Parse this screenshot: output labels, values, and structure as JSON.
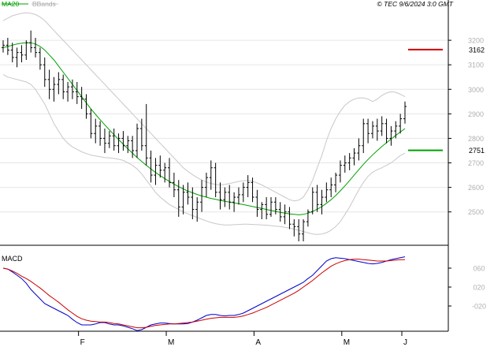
{
  "header": {
    "legend_ma": "MA20",
    "legend_bb": "BBands",
    "timestamp": "© TEC 9/6/2024 3:0 GMT"
  },
  "colors": {
    "bars": "#000000",
    "ma20": "#00a000",
    "bbands": "#c8c8c8",
    "grid": "#e6e6e6",
    "resistance": "#d00000",
    "support": "#00a000",
    "macd": "#0000cc",
    "signal": "#cc0000",
    "axis_text": "#b0b0b0"
  },
  "chart_data": [
    {
      "type": "ohlc",
      "title": "",
      "y_tick_labels": [
        "2500",
        "2600",
        "2700",
        "2800",
        "2900",
        "3000",
        "3100",
        "3200"
      ],
      "x_tick_labels": [
        "F",
        "M",
        "A",
        "M",
        "J"
      ],
      "ylim": [
        2380,
        3300
      ],
      "grid": true,
      "series": [
        {
          "name": "MA20",
          "type": "line",
          "values": [
            3170,
            3175,
            3180,
            3185,
            3188,
            3190,
            3190,
            3185,
            3175,
            3160,
            3140,
            3120,
            3095,
            3070,
            3045,
            3020,
            2995,
            2970,
            2945,
            2920,
            2898,
            2876,
            2855,
            2835,
            2815,
            2795,
            2776,
            2757,
            2740,
            2722,
            2706,
            2690,
            2675,
            2661,
            2648,
            2636,
            2624,
            2613,
            2603,
            2594,
            2585,
            2578,
            2571,
            2565,
            2560,
            2555,
            2551,
            2547,
            2543,
            2540,
            2537,
            2533,
            2530,
            2526,
            2522,
            2518,
            2514,
            2510,
            2506,
            2502,
            2498,
            2495,
            2492,
            2490,
            2488,
            2490,
            2495,
            2502,
            2511,
            2522,
            2535,
            2550,
            2567,
            2586,
            2606,
            2628,
            2650,
            2672,
            2694,
            2714,
            2733,
            2750,
            2767,
            2782,
            2797,
            2812,
            2826,
            2840
          ]
        },
        {
          "name": "BBands upper",
          "type": "line",
          "values": [
            3280,
            3290,
            3300,
            3305,
            3310,
            3312,
            3310,
            3305,
            3295,
            3280,
            3260,
            3240,
            3220,
            3200,
            3180,
            3160,
            3140,
            3120,
            3100,
            3080,
            3060,
            3040,
            3020,
            3000,
            2980,
            2960,
            2940,
            2920,
            2900,
            2880,
            2860,
            2840,
            2820,
            2800,
            2780,
            2760,
            2740,
            2720,
            2700,
            2680,
            2665,
            2652,
            2640,
            2630,
            2622,
            2616,
            2612,
            2610,
            2612,
            2616,
            2620,
            2624,
            2627,
            2628,
            2625,
            2618,
            2610,
            2600,
            2590,
            2580,
            2570,
            2560,
            2550,
            2545,
            2548,
            2560,
            2590,
            2630,
            2680,
            2730,
            2790,
            2840,
            2880,
            2910,
            2935,
            2950,
            2960,
            2965,
            2965,
            2960,
            2950,
            2960,
            2975,
            2985,
            2990,
            2988,
            2980,
            2970
          ]
        },
        {
          "name": "BBands lower",
          "type": "line",
          "values": [
            3060,
            3050,
            3045,
            3040,
            3035,
            3030,
            3020,
            3000,
            2970,
            2940,
            2900,
            2860,
            2830,
            2800,
            2780,
            2765,
            2755,
            2745,
            2738,
            2732,
            2728,
            2725,
            2722,
            2720,
            2718,
            2715,
            2710,
            2700,
            2690,
            2675,
            2655,
            2630,
            2605,
            2580,
            2560,
            2545,
            2530,
            2520,
            2510,
            2500,
            2492,
            2485,
            2478,
            2470,
            2463,
            2457,
            2452,
            2449,
            2447,
            2447,
            2448,
            2449,
            2450,
            2450,
            2449,
            2448,
            2447,
            2446,
            2444,
            2442,
            2440,
            2437,
            2434,
            2430,
            2425,
            2420,
            2415,
            2410,
            2408,
            2410,
            2415,
            2425,
            2440,
            2460,
            2490,
            2520,
            2555,
            2590,
            2620,
            2645,
            2662,
            2672,
            2680,
            2690,
            2700,
            2715,
            2730,
            2740
          ]
        },
        {
          "name": "OHLC",
          "type": "ohlc",
          "ohlc": [
            [
              3170,
              3200,
              3150,
              3180
            ],
            [
              3180,
              3210,
              3140,
              3160
            ],
            [
              3160,
              3190,
              3110,
              3130
            ],
            [
              3130,
              3170,
              3090,
              3150
            ],
            [
              3150,
              3180,
              3110,
              3140
            ],
            [
              3140,
              3200,
              3120,
              3190
            ],
            [
              3190,
              3240,
              3150,
              3170
            ],
            [
              3170,
              3210,
              3130,
              3150
            ],
            [
              3150,
              3170,
              3080,
              3100
            ],
            [
              3100,
              3130,
              3010,
              3040
            ],
            [
              3040,
              3080,
              2960,
              3000
            ],
            [
              3000,
              3050,
              2950,
              3020
            ],
            [
              3020,
              3070,
              2980,
              3040
            ],
            [
              3040,
              3060,
              2960,
              2990
            ],
            [
              2990,
              3030,
              2950,
              3010
            ],
            [
              3010,
              3040,
              2960,
              2990
            ],
            [
              2990,
              3030,
              2940,
              2970
            ],
            [
              2970,
              3010,
              2920,
              2960
            ],
            [
              2960,
              2980,
              2880,
              2900
            ],
            [
              2900,
              2920,
              2800,
              2820
            ],
            [
              2820,
              2880,
              2780,
              2850
            ],
            [
              2850,
              2870,
              2770,
              2800
            ],
            [
              2800,
              2840,
              2740,
              2780
            ],
            [
              2780,
              2830,
              2760,
              2810
            ],
            [
              2810,
              2840,
              2750,
              2770
            ],
            [
              2770,
              2820,
              2740,
              2800
            ],
            [
              2800,
              2830,
              2750,
              2770
            ],
            [
              2770,
              2810,
              2740,
              2790
            ],
            [
              2790,
              2810,
              2720,
              2750
            ],
            [
              2750,
              2860,
              2720,
              2840
            ],
            [
              2840,
              2880,
              2750,
              2770
            ],
            [
              2770,
              2940,
              2690,
              2720
            ],
            [
              2720,
              2750,
              2620,
              2650
            ],
            [
              2650,
              2720,
              2610,
              2690
            ],
            [
              2690,
              2730,
              2640,
              2670
            ],
            [
              2670,
              2700,
              2620,
              2680
            ],
            [
              2680,
              2720,
              2600,
              2620
            ],
            [
              2620,
              2660,
              2560,
              2590
            ],
            [
              2590,
              2630,
              2480,
              2520
            ],
            [
              2520,
              2610,
              2490,
              2580
            ],
            [
              2580,
              2620,
              2530,
              2560
            ],
            [
              2560,
              2600,
              2470,
              2510
            ],
            [
              2510,
              2560,
              2460,
              2540
            ],
            [
              2540,
              2630,
              2500,
              2600
            ],
            [
              2600,
              2660,
              2560,
              2640
            ],
            [
              2640,
              2710,
              2590,
              2680
            ],
            [
              2680,
              2700,
              2560,
              2580
            ],
            [
              2580,
              2620,
              2510,
              2550
            ],
            [
              2550,
              2600,
              2520,
              2580
            ],
            [
              2580,
              2610,
              2510,
              2540
            ],
            [
              2540,
              2580,
              2500,
              2560
            ],
            [
              2560,
              2600,
              2530,
              2570
            ],
            [
              2570,
              2620,
              2540,
              2600
            ],
            [
              2600,
              2650,
              2560,
              2620
            ],
            [
              2620,
              2640,
              2540,
              2560
            ],
            [
              2560,
              2590,
              2480,
              2510
            ],
            [
              2510,
              2540,
              2470,
              2530
            ],
            [
              2530,
              2560,
              2470,
              2490
            ],
            [
              2490,
              2560,
              2480,
              2540
            ],
            [
              2540,
              2560,
              2490,
              2510
            ],
            [
              2510,
              2540,
              2460,
              2480
            ],
            [
              2480,
              2530,
              2450,
              2500
            ],
            [
              2500,
              2520,
              2430,
              2450
            ],
            [
              2450,
              2470,
              2400,
              2440
            ],
            [
              2440,
              2470,
              2380,
              2410
            ],
            [
              2410,
              2470,
              2380,
              2460
            ],
            [
              2460,
              2510,
              2440,
              2500
            ],
            [
              2500,
              2600,
              2490,
              2580
            ],
            [
              2580,
              2610,
              2500,
              2530
            ],
            [
              2530,
              2590,
              2490,
              2560
            ],
            [
              2560,
              2620,
              2540,
              2590
            ],
            [
              2590,
              2640,
              2560,
              2610
            ],
            [
              2610,
              2660,
              2580,
              2650
            ],
            [
              2650,
              2710,
              2620,
              2690
            ],
            [
              2690,
              2730,
              2660,
              2700
            ],
            [
              2700,
              2740,
              2670,
              2720
            ],
            [
              2720,
              2760,
              2690,
              2740
            ],
            [
              2740,
              2800,
              2710,
              2770
            ],
            [
              2770,
              2880,
              2740,
              2860
            ],
            [
              2860,
              2880,
              2780,
              2820
            ],
            [
              2820,
              2870,
              2800,
              2850
            ],
            [
              2850,
              2880,
              2790,
              2830
            ],
            [
              2830,
              2890,
              2810,
              2860
            ],
            [
              2860,
              2880,
              2780,
              2800
            ],
            [
              2800,
              2850,
              2770,
              2830
            ],
            [
              2830,
              2870,
              2800,
              2850
            ],
            [
              2850,
              2900,
              2820,
              2880
            ],
            [
              2880,
              2950,
              2860,
              2930
            ]
          ]
        }
      ],
      "annotations": [
        {
          "label": "3162",
          "value": 3162,
          "role": "resistance"
        },
        {
          "label": "2751",
          "value": 2751,
          "role": "support"
        }
      ]
    },
    {
      "type": "line",
      "title": "MACD",
      "y_tick_labels": [
        "060",
        "020",
        "-020"
      ],
      "ylim": [
        -60,
        90
      ],
      "series": [
        {
          "name": "MACD",
          "values": [
            60,
            58,
            52,
            45,
            38,
            28,
            15,
            5,
            -5,
            -15,
            -20,
            -25,
            -30,
            -35,
            -40,
            -48,
            -55,
            -60,
            -60,
            -60,
            -58,
            -55,
            -55,
            -58,
            -60,
            -60,
            -62,
            -65,
            -68,
            -72,
            -70,
            -65,
            -60,
            -58,
            -56,
            -56,
            -57,
            -58,
            -58,
            -58,
            -57,
            -54,
            -50,
            -45,
            -40,
            -38,
            -38,
            -40,
            -41,
            -40,
            -40,
            -38,
            -35,
            -30,
            -25,
            -20,
            -15,
            -10,
            -5,
            0,
            5,
            10,
            15,
            20,
            25,
            30,
            38,
            45,
            55,
            65,
            75,
            80,
            82,
            81,
            80,
            78,
            76,
            74,
            72,
            70,
            69,
            70,
            72,
            75,
            78,
            80,
            82,
            84
          ]
        },
        {
          "name": "Signal",
          "values": [
            60,
            58,
            54,
            49,
            43,
            38,
            32,
            25,
            18,
            10,
            2,
            -5,
            -12,
            -20,
            -28,
            -35,
            -42,
            -47,
            -50,
            -52,
            -53,
            -54,
            -54,
            -55,
            -57,
            -58,
            -60,
            -62,
            -64,
            -66,
            -66,
            -65,
            -63,
            -61,
            -60,
            -59,
            -58,
            -58,
            -57,
            -56,
            -55,
            -54,
            -52,
            -50,
            -48,
            -46,
            -45,
            -44,
            -44,
            -44,
            -44,
            -43,
            -41,
            -38,
            -35,
            -31,
            -27,
            -23,
            -18,
            -13,
            -8,
            -3,
            2,
            7,
            13,
            20,
            27,
            34,
            42,
            50,
            57,
            64,
            69,
            73,
            76,
            78,
            79,
            79,
            78,
            77,
            76,
            75,
            75,
            75,
            76,
            77,
            78,
            78
          ]
        }
      ]
    }
  ]
}
